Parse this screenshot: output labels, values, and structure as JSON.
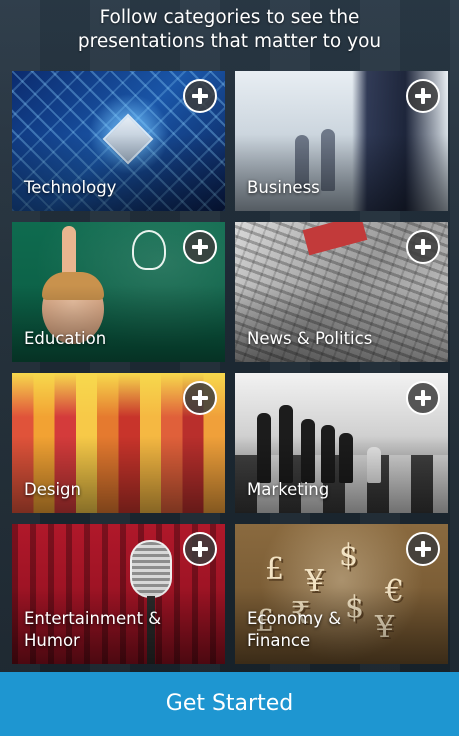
{
  "header": {
    "line1": "Follow categories to see the",
    "line2": "presentations that matter to you"
  },
  "categories": [
    {
      "label_lines": [
        "Technology"
      ],
      "action_icon": "plus-circle-icon"
    },
    {
      "label_lines": [
        "Business"
      ],
      "action_icon": "plus-circle-icon"
    },
    {
      "label_lines": [
        "Education"
      ],
      "action_icon": "plus-circle-icon"
    },
    {
      "label_lines": [
        "News & Politics"
      ],
      "action_icon": "plus-circle-icon"
    },
    {
      "label_lines": [
        "Design"
      ],
      "action_icon": "plus-circle-icon"
    },
    {
      "label_lines": [
        "Marketing"
      ],
      "action_icon": "plus-circle-icon"
    },
    {
      "label_lines": [
        "Entertainment &",
        "Humor"
      ],
      "action_icon": "plus-circle-icon"
    },
    {
      "label_lines": [
        "Economy & Finance"
      ],
      "action_icon": "plus-circle-icon"
    }
  ],
  "footer": {
    "button_label": "Get Started",
    "button_color": "#1e96d1"
  },
  "decor": {
    "economy_symbols": [
      "£",
      "¥",
      "$",
      "€",
      "₹",
      "$",
      "¥",
      "£"
    ]
  }
}
